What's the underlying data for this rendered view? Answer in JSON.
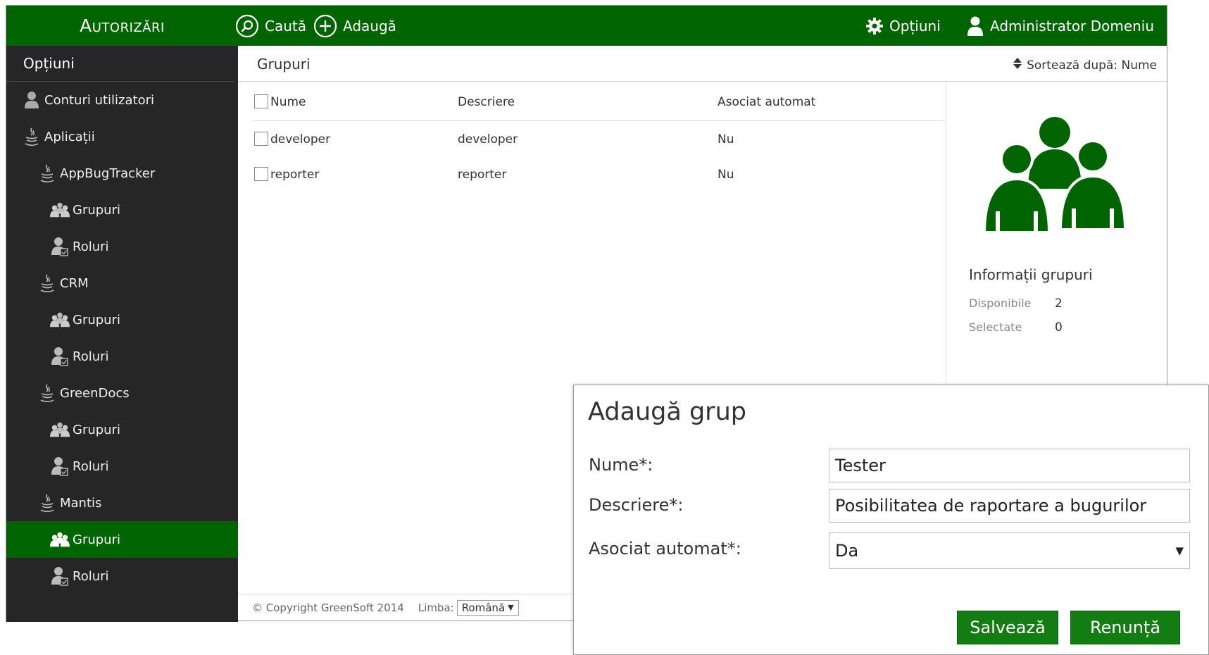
{
  "app": {
    "brand": "Autorizări"
  },
  "toolbar": {
    "search_label": "Caută",
    "add_label": "Adaugă",
    "options_label": "Opțiuni",
    "user_label": "Administrator Domeniu"
  },
  "sidebar": {
    "title": "Opțiuni",
    "items": [
      {
        "label": "Conturi utilizatori",
        "icon": "user-icon",
        "level": 0
      },
      {
        "label": "Aplicații",
        "icon": "java-icon",
        "level": 0
      },
      {
        "label": "AppBugTracker",
        "icon": "java-icon",
        "level": 1
      },
      {
        "label": "Grupuri",
        "icon": "group-icon",
        "level": 2
      },
      {
        "label": "Roluri",
        "icon": "role-icon",
        "level": 2
      },
      {
        "label": "CRM",
        "icon": "java-icon",
        "level": 1
      },
      {
        "label": "Grupuri",
        "icon": "group-icon",
        "level": 2
      },
      {
        "label": "Roluri",
        "icon": "role-icon",
        "level": 2
      },
      {
        "label": "GreenDocs",
        "icon": "java-icon",
        "level": 1
      },
      {
        "label": "Grupuri",
        "icon": "group-icon",
        "level": 2
      },
      {
        "label": "Roluri",
        "icon": "role-icon",
        "level": 2
      },
      {
        "label": "Mantis",
        "icon": "java-icon",
        "level": 1
      },
      {
        "label": "Grupuri",
        "icon": "group-icon",
        "level": 2,
        "active": true
      },
      {
        "label": "Roluri",
        "icon": "role-icon",
        "level": 2
      }
    ]
  },
  "main": {
    "title": "Grupuri",
    "sort_label": "Sortează după: Nume"
  },
  "table": {
    "columns": [
      "Nume",
      "Descriere",
      "Asociat automat"
    ],
    "rows": [
      {
        "name": "developer",
        "description": "developer",
        "auto": "Nu"
      },
      {
        "name": "reporter",
        "description": "reporter",
        "auto": "Nu"
      }
    ]
  },
  "info": {
    "title": "Informații grupuri",
    "available_label": "Disponibile",
    "available_value": "2",
    "selected_label": "Selectate",
    "selected_value": "0"
  },
  "footer": {
    "copyright": "© Copyright GreenSoft 2014",
    "language_label": "Limba:",
    "language_value": "Română"
  },
  "dialog": {
    "title": "Adaugă grup",
    "name_label": "Nume*:",
    "name_value": "Tester",
    "description_label": "Descriere*:",
    "description_value": "Posibilitatea de raportare a bugurilor",
    "auto_label": "Asociat automat*:",
    "auto_value": "Da",
    "save_label": "Salvează",
    "cancel_label": "Renunță"
  },
  "colors": {
    "primary": "#006400",
    "sidebar_bg": "#262626",
    "button": "#137c13"
  }
}
